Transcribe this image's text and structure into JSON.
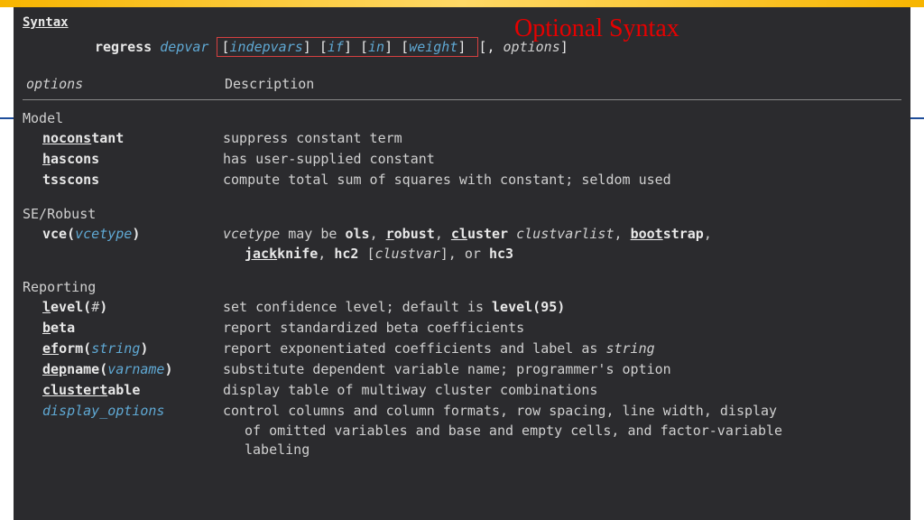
{
  "callout": "Optional Syntax",
  "header": "Syntax",
  "cmd": {
    "command": "regress",
    "depvar": "depvar",
    "indepvars": "indepvars",
    "if": "if",
    "in": "in",
    "weight": "weight",
    "tail_open": " [, ",
    "options": "options",
    "tail_close": "]"
  },
  "table_head": {
    "opt": "options",
    "desc": "Description"
  },
  "groups": {
    "model": {
      "title": "Model",
      "rows": [
        {
          "u": "nocons",
          "rest": "tant",
          "desc": "suppress constant term"
        },
        {
          "u": "h",
          "rest": "ascons",
          "desc": "has user-supplied constant"
        },
        {
          "u": "",
          "rest": "tsscons",
          "desc": "compute total sum of squares with constant; seldom used"
        }
      ]
    },
    "se": {
      "title": "SE/Robust",
      "vce_label": "vce(",
      "vce_arg": "vcetype",
      "vce_close": ")",
      "desc1_pre": "vcetype",
      "desc1_a": " may be ",
      "ols": "ols",
      "r_u": "r",
      "r_rest": "obust",
      "cl_u": "cl",
      "cl_rest": "uster",
      "clustvarlist": "clustvarlist",
      "boot_u": "boot",
      "boot_rest": "strap",
      "jack_u": "jack",
      "jack_rest": "knife",
      "hc2": "hc2",
      "clustvar": "clustvar",
      "hc3": "hc3",
      "or": ", or "
    },
    "reporting": {
      "title": "Reporting",
      "level_u": "l",
      "level_rest": "evel(",
      "level_arg": "#",
      "level_close": ")",
      "level_desc_a": "set confidence level; default is ",
      "level_def": "level(95)",
      "beta_u": "b",
      "beta_rest": "eta",
      "beta_desc": "report standardized beta coefficients",
      "eform_u": "ef",
      "eform_rest": "orm(",
      "eform_arg": "string",
      "eform_close": ")",
      "eform_desc_a": "report exponentiated coefficients and label as ",
      "eform_desc_b": "string",
      "dep_u": "dep",
      "dep_rest": "name(",
      "dep_arg": "varname",
      "dep_close": ")",
      "dep_desc": "substitute dependent variable name; programmer's option",
      "ct_u": "clustert",
      "ct_rest": "able",
      "ct_desc": "display table of multiway cluster combinations",
      "disp": "display_options",
      "disp_desc1": "control columns and column formats, row spacing, line width, display",
      "disp_desc2": "of omitted variables and base and empty cells, and factor-variable",
      "disp_desc3": "labeling"
    }
  }
}
